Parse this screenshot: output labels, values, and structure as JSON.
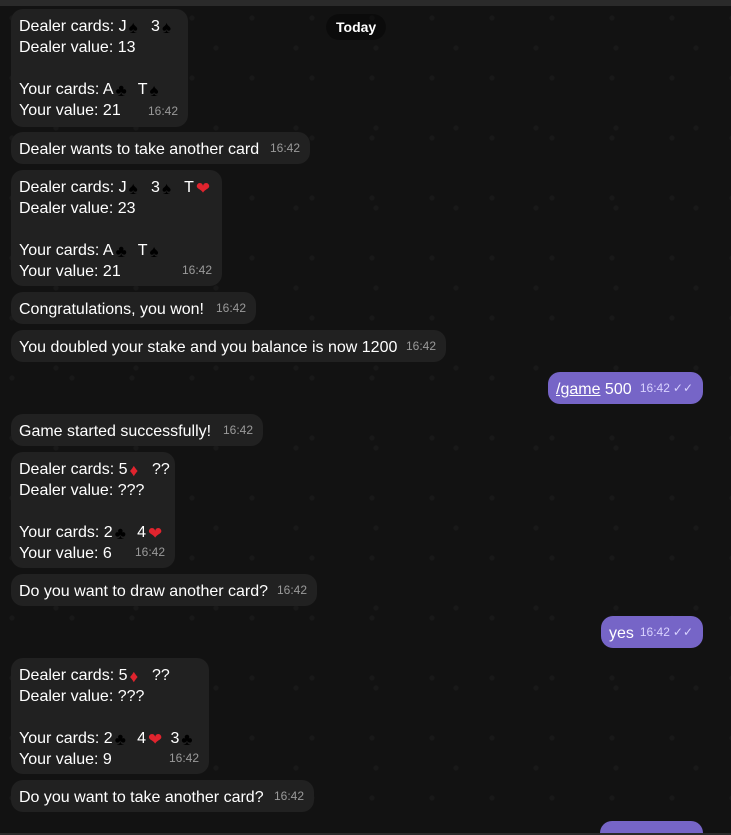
{
  "date_separator": "Today",
  "messages": [
    {
      "l1a": "Dealer cards: J",
      "c1": "♠",
      "l1b": " 3",
      "c2": "♠",
      "l2": "Dealer value: 13",
      "l4a": "Your cards: A",
      "c3": "♣",
      "l4b": " T",
      "c4": "♠",
      "l5": "Your value: 21",
      "time": "16:42"
    },
    {
      "text": "Dealer wants to take another card",
      "time": "16:42"
    },
    {
      "l1a": "Dealer cards: J",
      "c1": "♠",
      "l1b": " 3",
      "c2": "♠",
      "l1c": " T",
      "c5": "❤",
      "l2": "Dealer value: 23",
      "l4a": "Your cards: A",
      "c3": "♣",
      "l4b": " T",
      "c4": "♠",
      "l5": "Your value: 21",
      "time": "16:42"
    },
    {
      "text": "Congratulations, you won!",
      "time": "16:42"
    },
    {
      "text": "You doubled your stake and you balance is now 1200",
      "time": "16:42"
    },
    {
      "cmd": "/game",
      "arg": " 500",
      "time": "16:42",
      "ticks": "✓✓"
    },
    {
      "text": "Game started successfully!",
      "time": "16:42"
    },
    {
      "l1a": "Dealer cards: 5",
      "c1": "♦",
      "l1b": " ??",
      "l2": "Dealer value: ???",
      "l4a": "Your cards: 2",
      "c3": "♣",
      "l4b": " 4",
      "c4": "❤",
      "l5": "Your value: 6",
      "time": "16:42"
    },
    {
      "text": "Do you want to draw another card?",
      "time": "16:42"
    },
    {
      "text": "yes",
      "time": "16:42",
      "ticks": "✓✓"
    },
    {
      "l1a": "Dealer cards: 5",
      "c1": "♦",
      "l1b": " ??",
      "l2": "Dealer value: ???",
      "l4a": "Your cards: 2",
      "c3": "♣",
      "l4b": " 4",
      "c4": "❤",
      "l4c": " 3",
      "c5": "♣",
      "l5": "Your value: 9",
      "time": "16:42"
    },
    {
      "text": "Do you want to take another card?",
      "time": "16:42"
    }
  ]
}
